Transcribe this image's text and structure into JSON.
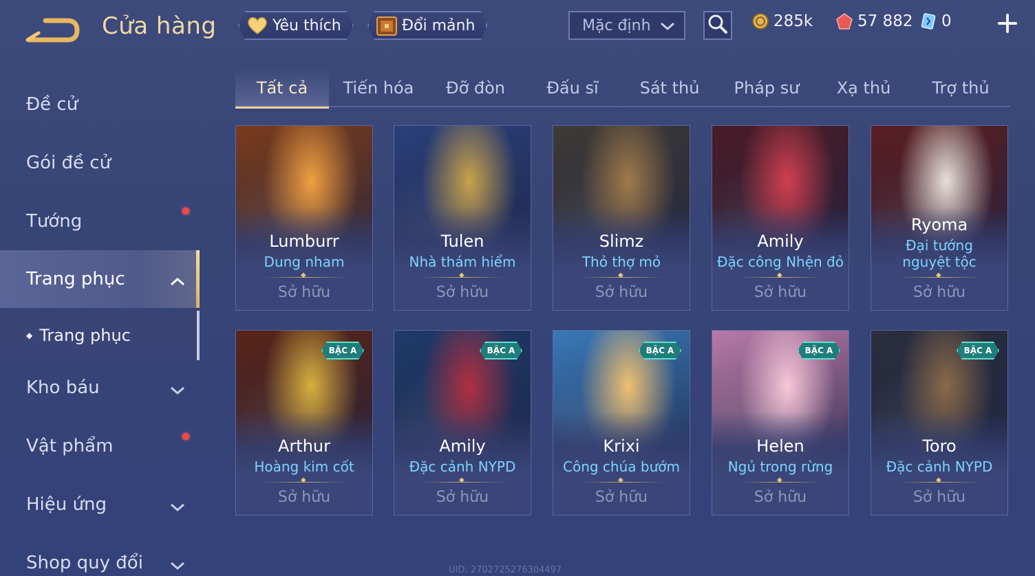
{
  "header": {
    "title": "Cửa hàng",
    "favorites_label": "Yêu thích",
    "exchange_label": "Đổi mảnh",
    "sort_selected": "Mặc định",
    "currencies": [
      {
        "name": "gold",
        "value": "285k",
        "color": "#e3b458"
      },
      {
        "name": "vouchers",
        "value": "57 882",
        "color": "#e85a5a"
      },
      {
        "name": "crystal",
        "value": "0",
        "color": "#7ec8ff"
      }
    ]
  },
  "sidebar": {
    "items": [
      {
        "label": "Đề cử"
      },
      {
        "label": "Gói đề cử"
      },
      {
        "label": "Tướng"
      },
      {
        "label": "Trang phục"
      },
      {
        "label": "Kho báu"
      },
      {
        "label": "Vật phẩm"
      },
      {
        "label": "Hiệu ứng"
      },
      {
        "label": "Shop quy đổi"
      }
    ],
    "sub_item": "Trang phục"
  },
  "tabs": [
    "Tất cả",
    "Tiến hóa",
    "Đỡ đòn",
    "Đấu sĩ",
    "Sát thủ",
    "Pháp sư",
    "Xạ thủ",
    "Trợ thủ"
  ],
  "cards": [
    {
      "hero": "Lumburr",
      "skin": "Dung nham",
      "status": "Sở hữu",
      "art_color": "#7a3b1c",
      "accent": "#f0a040"
    },
    {
      "hero": "Tulen",
      "skin": "Nhà thám hiểm",
      "status": "Sở hữu",
      "art_color": "#2a3f7a",
      "accent": "#c9a24a"
    },
    {
      "hero": "Slimz",
      "skin": "Thỏ thợ mỏ",
      "status": "Sở hữu",
      "art_color": "#3e3a36",
      "accent": "#a07a4a"
    },
    {
      "hero": "Amily",
      "skin": "Đặc công Nhện đỏ",
      "status": "Sở hữu",
      "art_color": "#4a1c28",
      "accent": "#d04050"
    },
    {
      "hero": "Ryoma",
      "skin": "Đại tướng nguyệt tộc",
      "status": "Sở hữu",
      "art_color": "#5a1e22",
      "accent": "#e8e0d8"
    },
    {
      "hero": "Arthur",
      "skin": "Hoàng kim cốt",
      "status": "Sở hữu",
      "badge": "BẬC A",
      "art_color": "#5a2418",
      "accent": "#d8b040"
    },
    {
      "hero": "Amily",
      "skin": "Đặc cảnh NYPD",
      "status": "Sở hữu",
      "badge": "BẬC A",
      "art_color": "#1e3a6a",
      "accent": "#b03040"
    },
    {
      "hero": "Krixi",
      "skin": "Công chúa bướm",
      "status": "Sở hữu",
      "badge": "BẬC A",
      "art_color": "#3a78b8",
      "accent": "#f0c070"
    },
    {
      "hero": "Helen",
      "skin": "Ngủ trong rừng",
      "status": "Sở hữu",
      "badge": "BẬC A",
      "art_color": "#b87aa8",
      "accent": "#f8c8d8"
    },
    {
      "hero": "Toro",
      "skin": "Đặc cảnh NYPD",
      "status": "Sở hữu",
      "badge": "BẬC A",
      "art_color": "#2a2e3e",
      "accent": "#8a6a4a"
    }
  ],
  "footer": {
    "uid": "UID: 2702725276304497"
  }
}
